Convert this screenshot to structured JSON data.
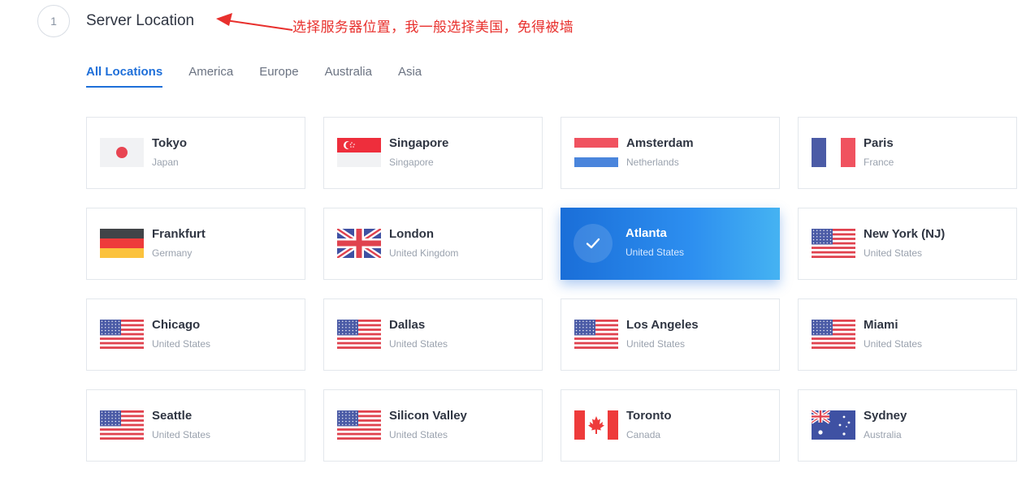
{
  "step": {
    "number": "1",
    "title": "Server Location"
  },
  "annotation": {
    "text": "选择服务器位置，我一般选择美国，免得被墙",
    "color": "#e8302d"
  },
  "tabs": [
    {
      "label": "All Locations",
      "active": true
    },
    {
      "label": "America",
      "active": false
    },
    {
      "label": "Europe",
      "active": false
    },
    {
      "label": "Australia",
      "active": false
    },
    {
      "label": "Asia",
      "active": false
    }
  ],
  "accent_color": "#1e6fd9",
  "locations": [
    {
      "city": "Tokyo",
      "country": "Japan",
      "flag": "jp"
    },
    {
      "city": "Singapore",
      "country": "Singapore",
      "flag": "sg"
    },
    {
      "city": "Amsterdam",
      "country": "Netherlands",
      "flag": "nl"
    },
    {
      "city": "Paris",
      "country": "France",
      "flag": "fr"
    },
    {
      "city": "Frankfurt",
      "country": "Germany",
      "flag": "de"
    },
    {
      "city": "London",
      "country": "United Kingdom",
      "flag": "gb"
    },
    {
      "city": "Atlanta",
      "country": "United States",
      "flag": "us",
      "selected": true
    },
    {
      "city": "New York (NJ)",
      "country": "United States",
      "flag": "us"
    },
    {
      "city": "Chicago",
      "country": "United States",
      "flag": "us"
    },
    {
      "city": "Dallas",
      "country": "United States",
      "flag": "us"
    },
    {
      "city": "Los Angeles",
      "country": "United States",
      "flag": "us"
    },
    {
      "city": "Miami",
      "country": "United States",
      "flag": "us"
    },
    {
      "city": "Seattle",
      "country": "United States",
      "flag": "us"
    },
    {
      "city": "Silicon Valley",
      "country": "United States",
      "flag": "us"
    },
    {
      "city": "Toronto",
      "country": "Canada",
      "flag": "ca"
    },
    {
      "city": "Sydney",
      "country": "Australia",
      "flag": "au"
    }
  ]
}
